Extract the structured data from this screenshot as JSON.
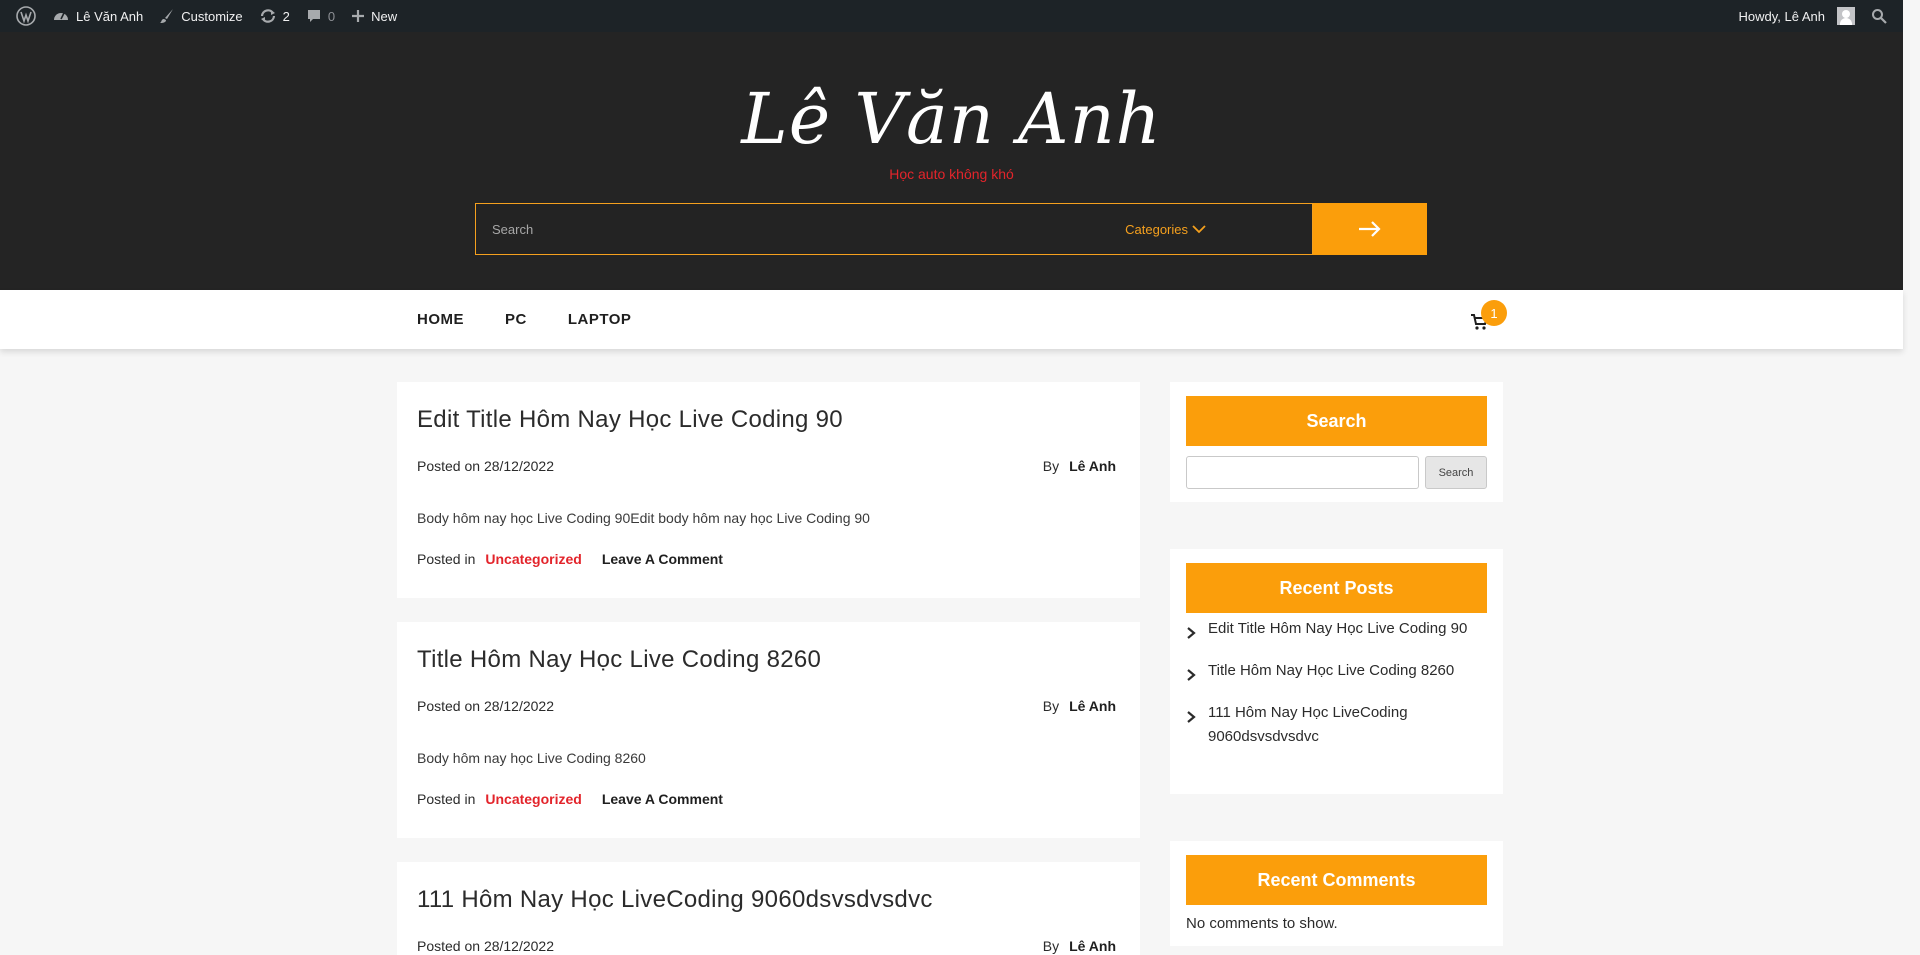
{
  "adminbar": {
    "site_name": "Lê Văn Anh",
    "customize": "Customize",
    "updates_count": "2",
    "comments_count": "0",
    "new": "New",
    "howdy": "Howdy, Lê Anh"
  },
  "header": {
    "site_title": "Lê Văn Anh",
    "tagline": "Học auto không khó",
    "search_placeholder": "Search",
    "categories_label": "Categories"
  },
  "nav": {
    "items": [
      {
        "label": "HOME"
      },
      {
        "label": "PC"
      },
      {
        "label": "LAPTOP"
      }
    ],
    "cart_count": "1"
  },
  "posts": [
    {
      "title": "Edit Title Hôm Nay Học Live Coding 90",
      "date": "Posted on 28/12/2022",
      "by_label": "By",
      "author": "Lê Anh",
      "body": "Body hôm nay học Live Coding 90Edit body hôm nay học Live Coding 90",
      "posted_in": "Posted in",
      "category": "Uncategorized",
      "comment_link": "Leave A Comment"
    },
    {
      "title": "Title Hôm Nay Học Live Coding 8260",
      "date": "Posted on 28/12/2022",
      "by_label": "By",
      "author": "Lê Anh",
      "body": "Body hôm nay học Live Coding 8260",
      "posted_in": "Posted in",
      "category": "Uncategorized",
      "comment_link": "Leave A Comment"
    },
    {
      "title": "111 Hôm Nay Học LiveCoding 9060dsvsdvsdvc",
      "date": "Posted on 28/12/2022",
      "by_label": "By",
      "author": "Lê Anh"
    }
  ],
  "sidebar": {
    "search_title": "Search",
    "search_button": "Search",
    "recent_posts_title": "Recent Posts",
    "recent_posts": [
      "Edit Title Hôm Nay Học Live Coding 90",
      "Title Hôm Nay Học Live Coding 8260",
      "111 Hôm Nay Học LiveCoding 9060dsvsdvsdvc"
    ],
    "recent_comments_title": "Recent Comments",
    "recent_comments_empty": "No comments to show."
  },
  "colors": {
    "accent": "#fb9e0b",
    "header_bg": "#242424",
    "adminbar_bg": "#1d2327",
    "category_red": "#e3242b"
  }
}
